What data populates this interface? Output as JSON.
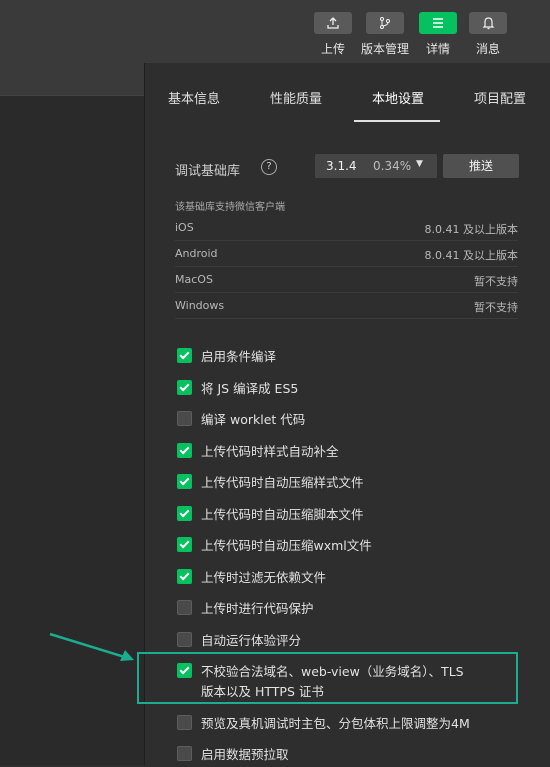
{
  "toolbar": {
    "upload": {
      "label": "上传",
      "icon": "upload-icon"
    },
    "version": {
      "label": "版本管理",
      "icon": "branch-icon"
    },
    "details": {
      "label": "详情",
      "icon": "menu-icon"
    },
    "messages": {
      "label": "消息",
      "icon": "bell-icon"
    }
  },
  "tabs": [
    {
      "label": "基本信息"
    },
    {
      "label": "性能质量"
    },
    {
      "label": "本地设置",
      "active": true
    },
    {
      "label": "项目配置"
    }
  ],
  "debug_lib": {
    "label": "调试基础库",
    "help": "?",
    "version": "3.1.4",
    "percent": "0.34%",
    "push_label": "推送"
  },
  "support": {
    "title": "该基础库支持微信客户端",
    "platforms": [
      {
        "name": "iOS",
        "version": "8.0.41 及以上版本"
      },
      {
        "name": "Android",
        "version": "8.0.41 及以上版本"
      },
      {
        "name": "MacOS",
        "version": "暂不支持"
      },
      {
        "name": "Windows",
        "version": "暂不支持"
      }
    ]
  },
  "options": [
    {
      "label": "启用条件编译",
      "checked": true
    },
    {
      "label": "将 JS 编译成 ES5",
      "checked": true
    },
    {
      "label": "编译 worklet 代码",
      "checked": false
    },
    {
      "label": "上传代码时样式自动补全",
      "checked": true
    },
    {
      "label": "上传代码时自动压缩样式文件",
      "checked": true
    },
    {
      "label": "上传代码时自动压缩脚本文件",
      "checked": true
    },
    {
      "label": "上传代码时自动压缩wxml文件",
      "checked": true
    },
    {
      "label": "上传时过滤无依赖文件",
      "checked": true
    },
    {
      "label": "上传时进行代码保护",
      "checked": false
    },
    {
      "label": "自动运行体验评分",
      "checked": false
    },
    {
      "label": "不校验合法域名、web-view（业务域名）、TLS",
      "label2": "版本以及 HTTPS 证书",
      "checked": true
    },
    {
      "label": "预览及真机调试时主包、分包体积上限调整为4M",
      "checked": false
    },
    {
      "label": "启用数据预拉取",
      "checked": false
    }
  ],
  "colors": {
    "accent": "#07c160",
    "highlight": "#1aad8f"
  }
}
